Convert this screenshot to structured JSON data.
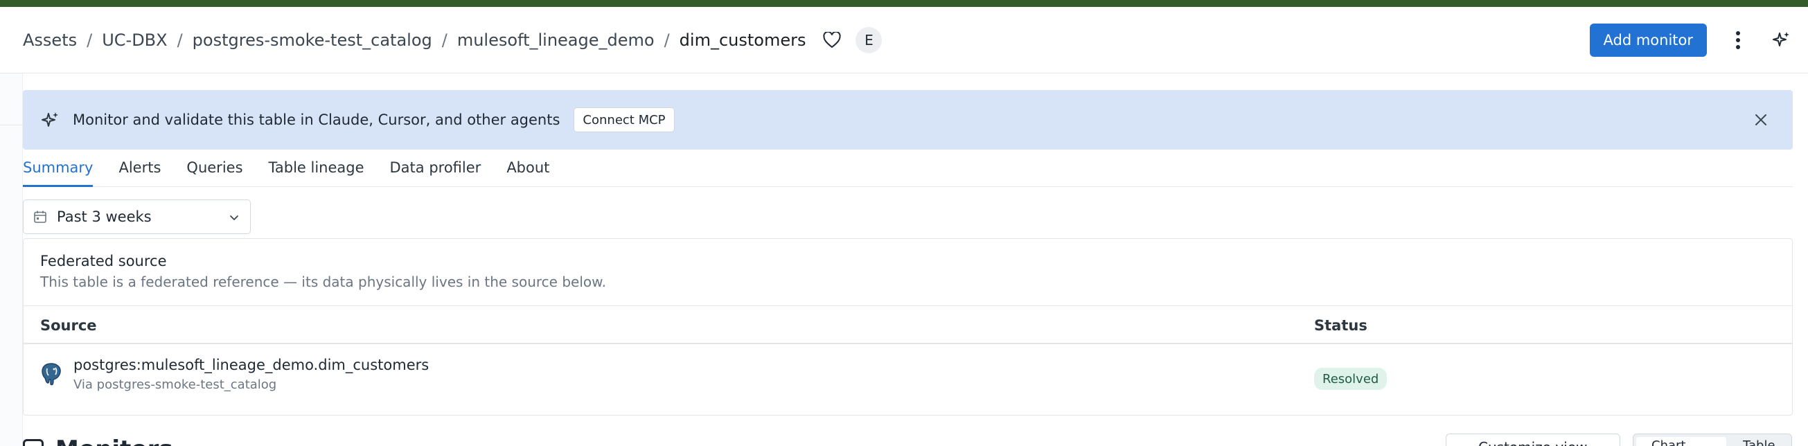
{
  "breadcrumb": {
    "items": [
      "Assets",
      "UC-DBX",
      "postgres-smoke-test_catalog",
      "mulesoft_lineage_demo",
      "dim_customers"
    ],
    "separator": "/"
  },
  "header": {
    "avatar_initial": "E",
    "add_monitor_label": "Add monitor",
    "icons": [
      "heart-icon",
      "kebab-menu-icon",
      "sparkle-icon"
    ]
  },
  "banner": {
    "text": "Monitor and validate this table in Claude, Cursor, and other agents",
    "button_label": "Connect MCP",
    "icons": [
      "sparkle-icon",
      "close-icon"
    ]
  },
  "tabs": [
    {
      "label": "Summary",
      "active": true
    },
    {
      "label": "Alerts",
      "active": false
    },
    {
      "label": "Queries",
      "active": false
    },
    {
      "label": "Table lineage",
      "active": false
    },
    {
      "label": "Data profiler",
      "active": false
    },
    {
      "label": "About",
      "active": false
    }
  ],
  "date_range": {
    "selected": "Past 3 weeks",
    "icons": [
      "calendar-icon",
      "chevron-down-icon"
    ]
  },
  "federated": {
    "title": "Federated source",
    "description": "This table is a federated reference — its data physically lives in the source below.",
    "columns": [
      "Source",
      "Status"
    ],
    "rows": [
      {
        "source": "postgres:mulesoft_lineage_demo.dim_customers",
        "via": "Via postgres-smoke-test_catalog",
        "status": "Resolved",
        "icon": "postgres-elephant-icon"
      }
    ]
  },
  "monitors_section": {
    "title": "Monitors",
    "customize_label": "Customize view",
    "view_toggle": [
      "Chart",
      "Table"
    ]
  },
  "colors": {
    "top_bar": "#345b2a",
    "accent": "#2272d4",
    "banner_bg": "#d7e4f7",
    "resolved_bg": "#dff3ea"
  }
}
